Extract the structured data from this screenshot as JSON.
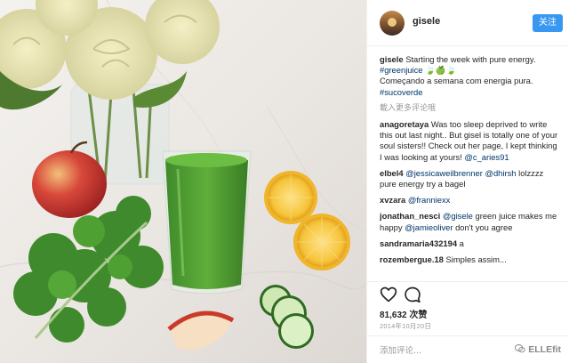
{
  "post": {
    "username": "gisele",
    "follow_label": "关注",
    "caption": {
      "username": "gisele",
      "text_1": "Starting the week with pure energy.",
      "hashtag_1": "#greenjuice",
      "emoji": "🍃🍏🍃",
      "text_2": "Começando a semana com energia pura.",
      "hashtag_2": "#sucoverde"
    },
    "load_more": "載入更多评论哦",
    "comments": [
      {
        "username": "anagoretaya",
        "text": "Was too sleep deprived to write this out last night.. But gisel is totally one of your soul sisters!! Check out her page, I kept thinking I was looking at yours!",
        "mention": "@c_aries91",
        "after": ""
      },
      {
        "username": "elbel4",
        "text": "",
        "mention": "@jessicaweilbrenner",
        "mention_2": "@dhirsh",
        "after": "lolzzzz pure energy try a bagel"
      },
      {
        "username": "xvzara",
        "text": "",
        "mention": "@franniexx",
        "after": ""
      },
      {
        "username": "jonathan_nesci",
        "text": "",
        "mention": "@gisele",
        "after": "green juice makes me happy",
        "mention_2": "@jamieoliver",
        "after_2": "don't you agree"
      },
      {
        "username": "sandramaria432194",
        "text": "a",
        "mention": "",
        "after": ""
      },
      {
        "username": "rozembergue.18",
        "text": "Simples assim...",
        "mention": "",
        "after": ""
      }
    ],
    "likes": "81,632 次赞",
    "date": "2014年10月20日",
    "add_comment_placeholder": "添加评论...",
    "watermark": "ELLEfit"
  },
  "icons": {
    "like": "heart-icon",
    "comment": "comment-icon",
    "watermark": "wechat-icon"
  },
  "colors": {
    "follow_button": "#3897f0",
    "link": "#003569",
    "muted": "#999999"
  }
}
